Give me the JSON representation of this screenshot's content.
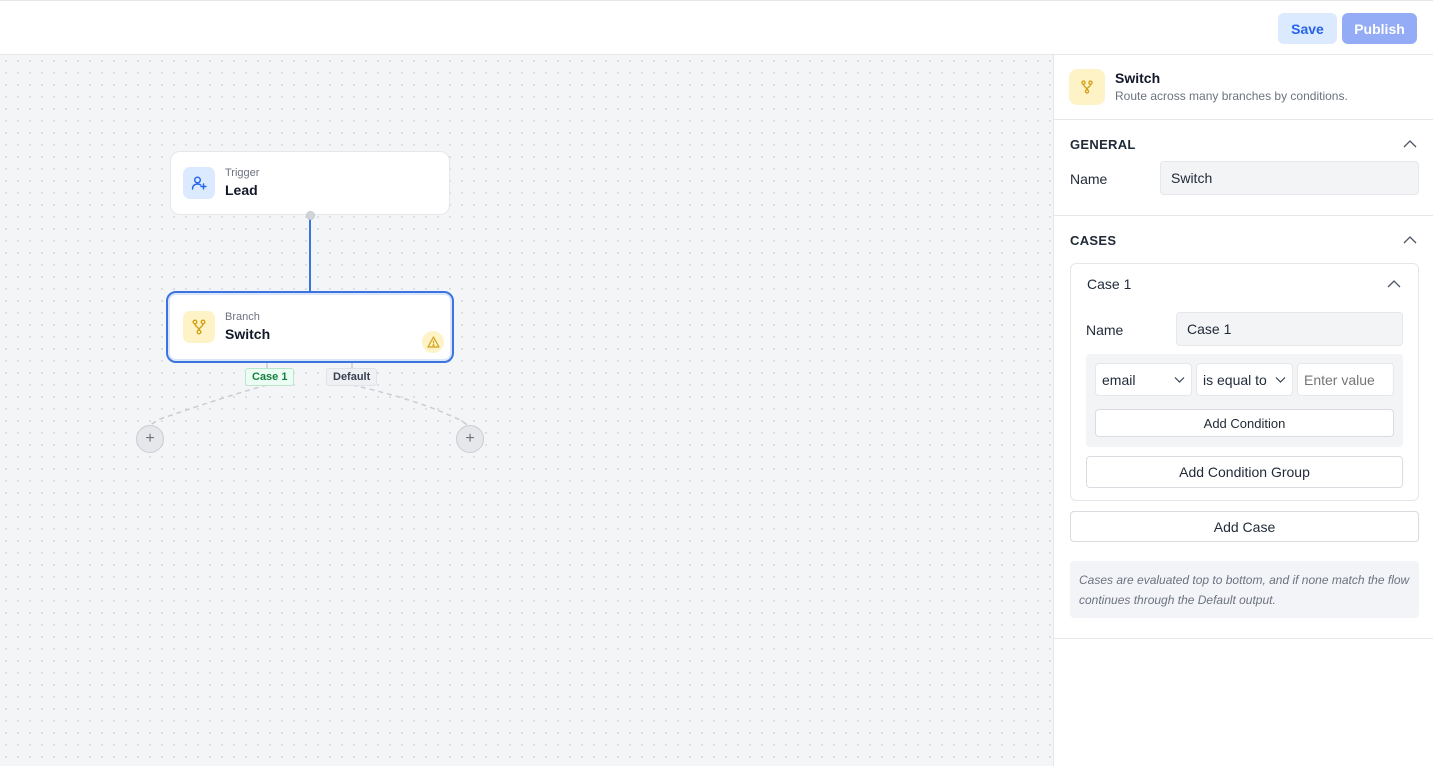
{
  "toolbar": {
    "save_label": "Save",
    "publish_label": "Publish"
  },
  "canvas": {
    "trigger_node": {
      "subtitle": "Trigger",
      "title": "Lead",
      "icon": "user-plus-icon"
    },
    "switch_node": {
      "subtitle": "Branch",
      "title": "Switch",
      "icon": "branch-icon",
      "status_icon": "warning-icon"
    },
    "branch_labels": {
      "case1": "Case 1",
      "default": "Default"
    },
    "add_glyph": "+"
  },
  "panel": {
    "header": {
      "title": "Switch",
      "description": "Route across many branches by conditions.",
      "icon": "branch-icon"
    },
    "general": {
      "title": "GENERAL",
      "name_label": "Name",
      "name_value": "Switch"
    },
    "cases": {
      "title": "CASES",
      "case": {
        "title": "Case 1",
        "name_label": "Name",
        "name_value": "Case 1",
        "condition": {
          "field": "email",
          "operator": "is equal to",
          "value_placeholder": "Enter value"
        },
        "add_condition_label": "Add Condition",
        "add_condition_group_label": "Add Condition Group"
      },
      "add_case_label": "Add Case",
      "note": "Cases are evaluated top to bottom, and if none match the flow continues through the Default output."
    }
  },
  "colors": {
    "accent": "#3b73e0",
    "save_bg": "#dbeafe",
    "publish_bg": "#93acf5",
    "branch_icon": "#d4a017",
    "trigger_icon": "#2563eb"
  }
}
